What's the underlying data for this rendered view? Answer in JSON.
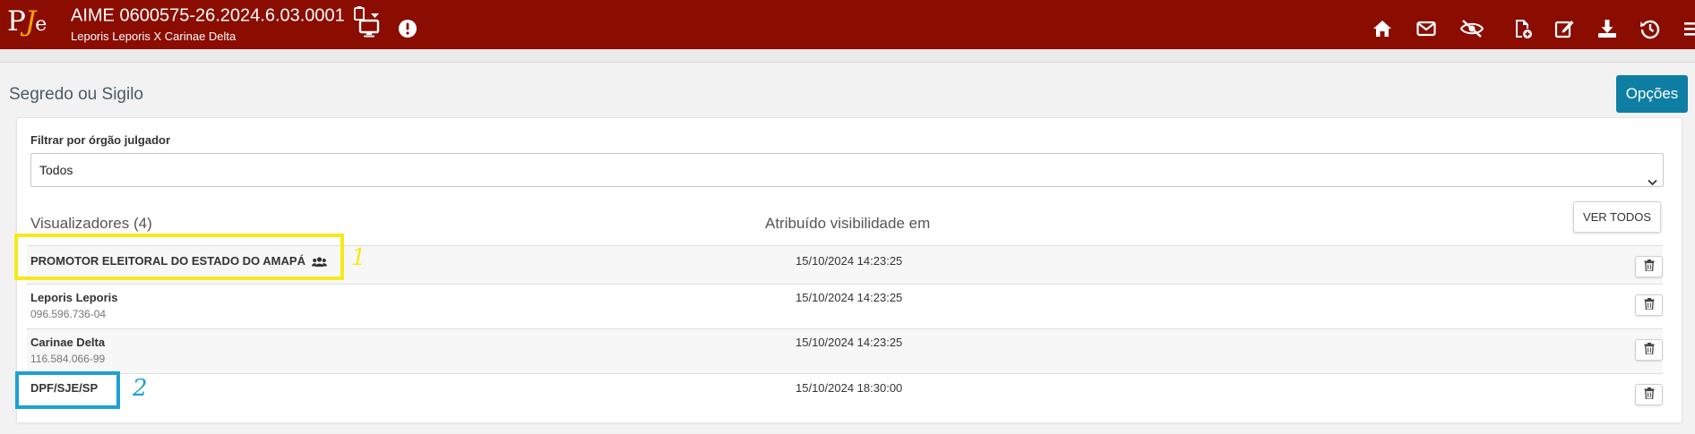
{
  "header": {
    "logo_text": "PJe",
    "process_number": "AIME 0600575-26.2024.6.03.0001",
    "parties": "Leporis Leporis X Carinae Delta",
    "bar_color": "#8b0c00",
    "logo_accent": "#f7a100",
    "icons_left": [
      "clipboard-icon",
      "caret-down-icon",
      "monitor-icon",
      "alert-icon"
    ],
    "icons_right": [
      "home-icon",
      "mail-icon",
      "eye-slash-icon",
      "file-add-icon",
      "edit-icon",
      "download-icon",
      "history-icon",
      "menu-icon"
    ]
  },
  "page": {
    "title": "Segredo ou Sigilo",
    "options_button": "Opções",
    "accent": "#0e7fa2"
  },
  "filter": {
    "label": "Filtrar por órgão julgador",
    "selected": "Todos"
  },
  "table": {
    "col_viewers": "Visualizadores (4)",
    "col_assigned": "Atribuído visibilidade em",
    "see_all_button": "VER TODOS",
    "rows": [
      {
        "name": "PROMOTOR ELEITORAL DO ESTADO DO AMAPÁ",
        "doc": "",
        "date": "15/10/2024 14:23:25",
        "icon": "users-icon"
      },
      {
        "name": "Leporis Leporis",
        "doc": "096.596.736-04",
        "date": "15/10/2024 14:23:25"
      },
      {
        "name": "Carinae Delta",
        "doc": "116.584.066-99",
        "date": "15/10/2024 14:23:25"
      },
      {
        "name": "DPF/SJE/SP",
        "doc": "",
        "date": "15/10/2024 18:30:00"
      }
    ]
  },
  "annotations": [
    {
      "label": "1",
      "color": "#f5ea1a"
    },
    {
      "label": "2",
      "color": "#1ea0d6"
    }
  ]
}
